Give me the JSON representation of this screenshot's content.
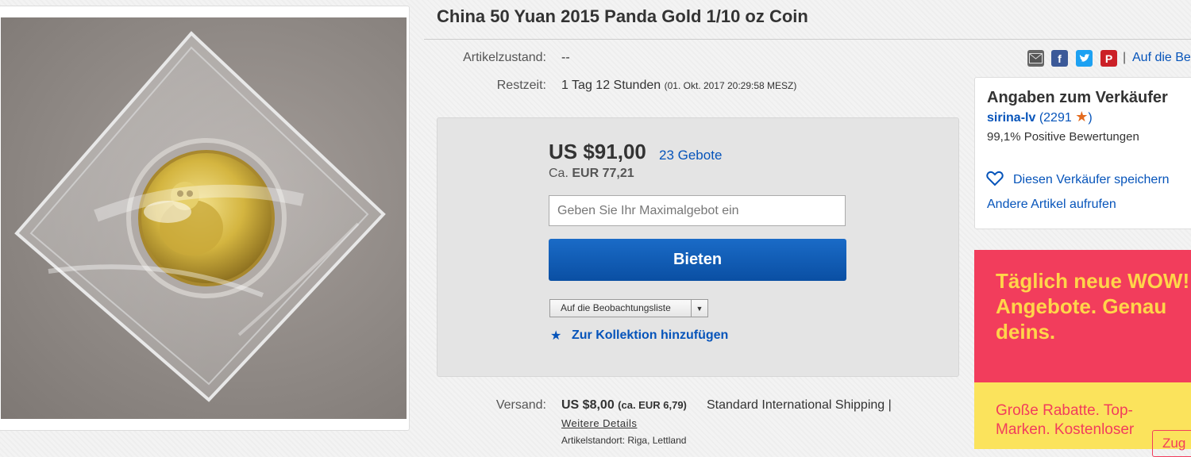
{
  "title": "China 50 Yuan 2015 Panda Gold 1/10 oz Coin",
  "condition": {
    "label": "Artikelzustand:",
    "value": "--"
  },
  "time_left": {
    "label": "Restzeit:",
    "value": "1 Tag 12 Stunden",
    "end": "(01. Okt. 2017   20:29:58 MESZ)"
  },
  "share": {
    "icons": [
      "mail-icon",
      "facebook-icon",
      "twitter-icon",
      "pinterest-icon"
    ],
    "separator": "|",
    "watch_link": "Auf die Be"
  },
  "bid": {
    "price": "US $91,00",
    "bids_count": "23 Gebote",
    "converted_prefix": "Ca.",
    "converted_value": "EUR 77,21",
    "input_placeholder": "Geben Sie Ihr Maximalgebot ein",
    "button": "Bieten",
    "watchlist_dropdown": "Auf die Beobachtungsliste",
    "collection_link": "Zur Kollektion hinzufügen"
  },
  "seller": {
    "heading": "Angaben zum Verkäufer",
    "name": "sirina-lv",
    "score_open": "(",
    "score": "2291",
    "score_close": ")",
    "positive": "99,1% Positive Bewertungen",
    "save_link": "Diesen Verkäufer speichern",
    "other_link": "Andere Artikel aufrufen"
  },
  "ad": {
    "headline": "Täglich neue WOW! Angebote. Genau deins.",
    "subline": "Große Rabatte. Top-Marken. Kostenloser",
    "button": "Zug",
    "colors": {
      "top": "#f23d5c",
      "bottom": "#fbe35c",
      "headline": "#ffd54a"
    }
  },
  "shipping": {
    "label": "Versand:",
    "price": "US $8,00",
    "converted": "(ca. EUR 6,79)",
    "method": "Standard International Shipping |",
    "details_link": "Weitere Details",
    "location_label": "Artikelstandort:",
    "location_value": "Riga, Lettland"
  },
  "colors": {
    "link": "#0654ba",
    "bid_button": "#0a5cba",
    "star": "#e36b1f"
  }
}
